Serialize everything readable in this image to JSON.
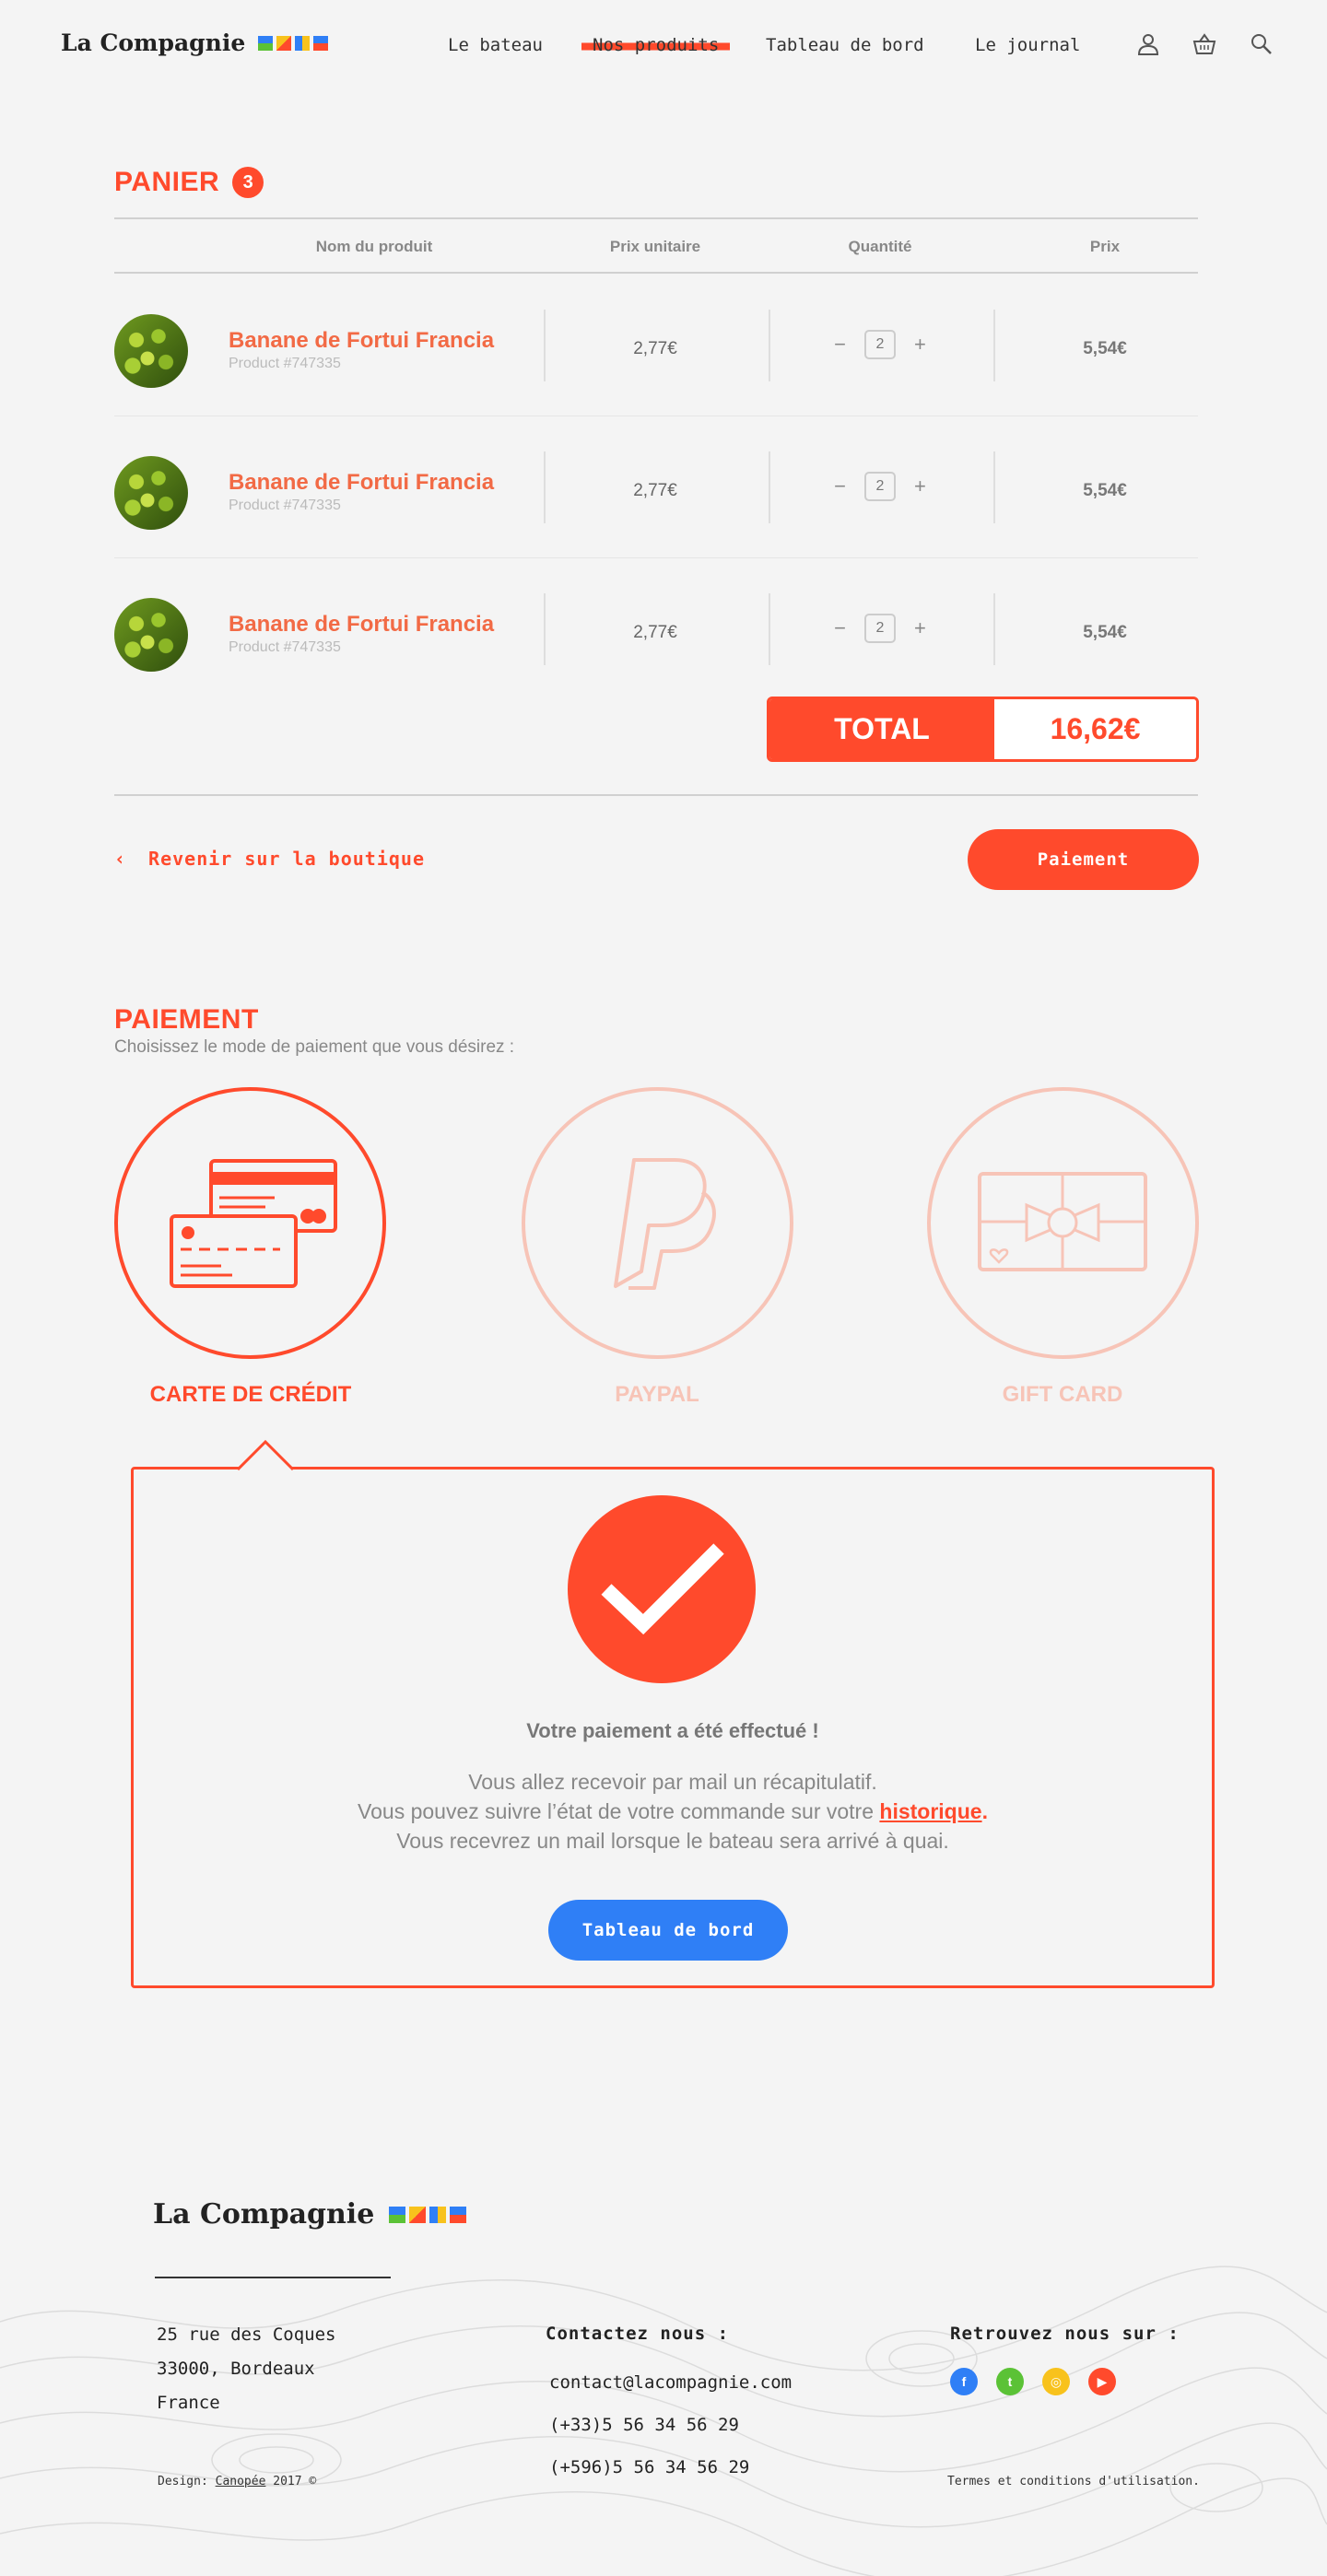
{
  "header": {
    "brand": "La Compagnie",
    "brand_colors": [
      "#2f7ff6",
      "#5bc236",
      "#ff4a2c",
      "#f8c21c"
    ],
    "nav": [
      "Le bateau",
      "Nos produits",
      "Tableau de bord",
      "Le journal"
    ],
    "active_nav": "Nos produits",
    "icons": [
      "user-icon",
      "basket-icon",
      "search-icon"
    ]
  },
  "cart": {
    "title": "PANIER",
    "count": "3",
    "columns": [
      "Nom du produit",
      "Prix unitaire",
      "Quantité",
      "Prix"
    ],
    "items": [
      {
        "name": "Banane de Fortui Francia",
        "ref": "Product #747335",
        "unit_price": "2,77€",
        "qty": "2",
        "price": "5,54€"
      },
      {
        "name": "Banane de Fortui Francia",
        "ref": "Product #747335",
        "unit_price": "2,77€",
        "qty": "2",
        "price": "5,54€"
      },
      {
        "name": "Banane de Fortui Francia",
        "ref": "Product #747335",
        "unit_price": "2,77€",
        "qty": "2",
        "price": "5,54€"
      }
    ],
    "minus": "−",
    "plus": "+",
    "total_label": "TOTAL",
    "total_value": "16,62€",
    "back_arrow": "‹",
    "back_label": "Revenir sur la boutique",
    "pay_button": "Paiement"
  },
  "payment": {
    "title": "PAIEMENT",
    "subtitle": "Choisissez le mode de paiement que vous désirez :",
    "methods": [
      {
        "label": "CARTE DE CRÉDIT",
        "icon": "credit-card-icon",
        "selected": true
      },
      {
        "label": "PAYPAL",
        "icon": "paypal-icon",
        "selected": false
      },
      {
        "label": "GIFT CARD",
        "icon": "gift-card-icon",
        "selected": false
      }
    ],
    "confirm_title": "Votre paiement a été effectué !",
    "line1": "Vous allez recevoir par mail un récapitulatif.",
    "line2_before": "Vous pouvez suivre l’état de votre commande sur votre ",
    "line2_link": "historique",
    "line2_after": ".",
    "line3": "Vous recevrez un mail lorsque le bateau sera arrivé à quai.",
    "dashboard_button": "Tableau de bord",
    "accent": "#ff4a2c"
  },
  "footer": {
    "brand": "La Compagnie",
    "address": [
      "25 rue des Coques",
      "33000, Bordeaux",
      "France"
    ],
    "contact_title": "Contactez nous :",
    "email": "contact@lacompagnie.com",
    "phone1": "(+33)5 56 34 56 29",
    "phone2": "(+596)5 56 34 56 29",
    "social_title": "Retrouvez nous sur :",
    "social": [
      {
        "name": "facebook-icon",
        "glyph": "f",
        "color": "#2f7ff6"
      },
      {
        "name": "twitter-icon",
        "glyph": "t",
        "color": "#5bc236"
      },
      {
        "name": "instagram-icon",
        "glyph": "◎",
        "color": "#f8c21c"
      },
      {
        "name": "youtube-icon",
        "glyph": "▶",
        "color": "#ff4a2c"
      }
    ],
    "design_prefix": "Design: ",
    "design_link": "Canopée",
    "design_suffix": " 2017 ©",
    "terms": "Termes et conditions d'utilisation."
  }
}
